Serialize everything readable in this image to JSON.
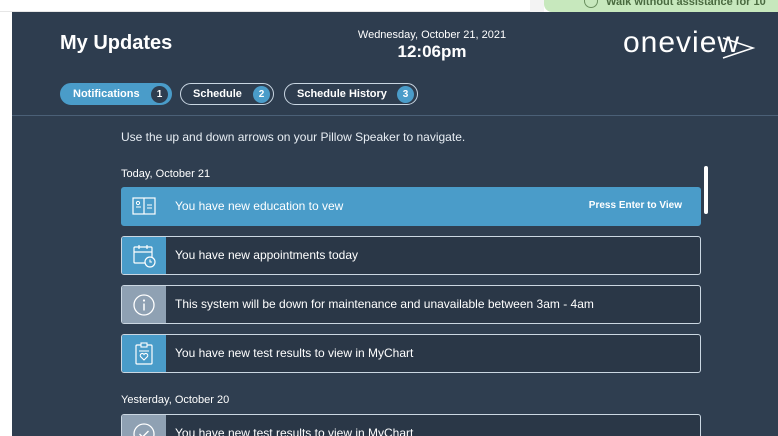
{
  "background_card": {
    "text": "Walk without assistance for 10"
  },
  "header": {
    "title": "My Updates",
    "date": "Wednesday, October 21, 2021",
    "time": "12:06pm",
    "brand": "oneview"
  },
  "tabs": [
    {
      "label": "Notifications",
      "count": "1",
      "active": true
    },
    {
      "label": "Schedule",
      "count": "2",
      "active": false
    },
    {
      "label": "Schedule History",
      "count": "3",
      "active": false
    }
  ],
  "hint": "Use the up and down arrows on your Pillow Speaker to navigate.",
  "sections": [
    {
      "heading": "Today, October 21",
      "items": [
        {
          "icon": "book-icon",
          "text": "You have new education to vew",
          "action": "Press Enter to View",
          "selected": true
        },
        {
          "icon": "calendar-clock-icon",
          "text": "You have new appointments today"
        },
        {
          "icon": "info-icon",
          "text": "This system will be down for maintenance and unavailable between 3am - 4am"
        },
        {
          "icon": "clipboard-heart-icon",
          "text": "You have new test results to view in MyChart"
        }
      ]
    },
    {
      "heading": "Yesterday, October 20",
      "items": [
        {
          "icon": "check-circle-icon",
          "text": "You have new test results to view in MyChart"
        }
      ]
    }
  ],
  "colors": {
    "panel_bg": "#2e3d4f",
    "accent": "#4a9cc9",
    "info_gray": "#8fa1b3",
    "item_border": "#cbd7e2"
  }
}
